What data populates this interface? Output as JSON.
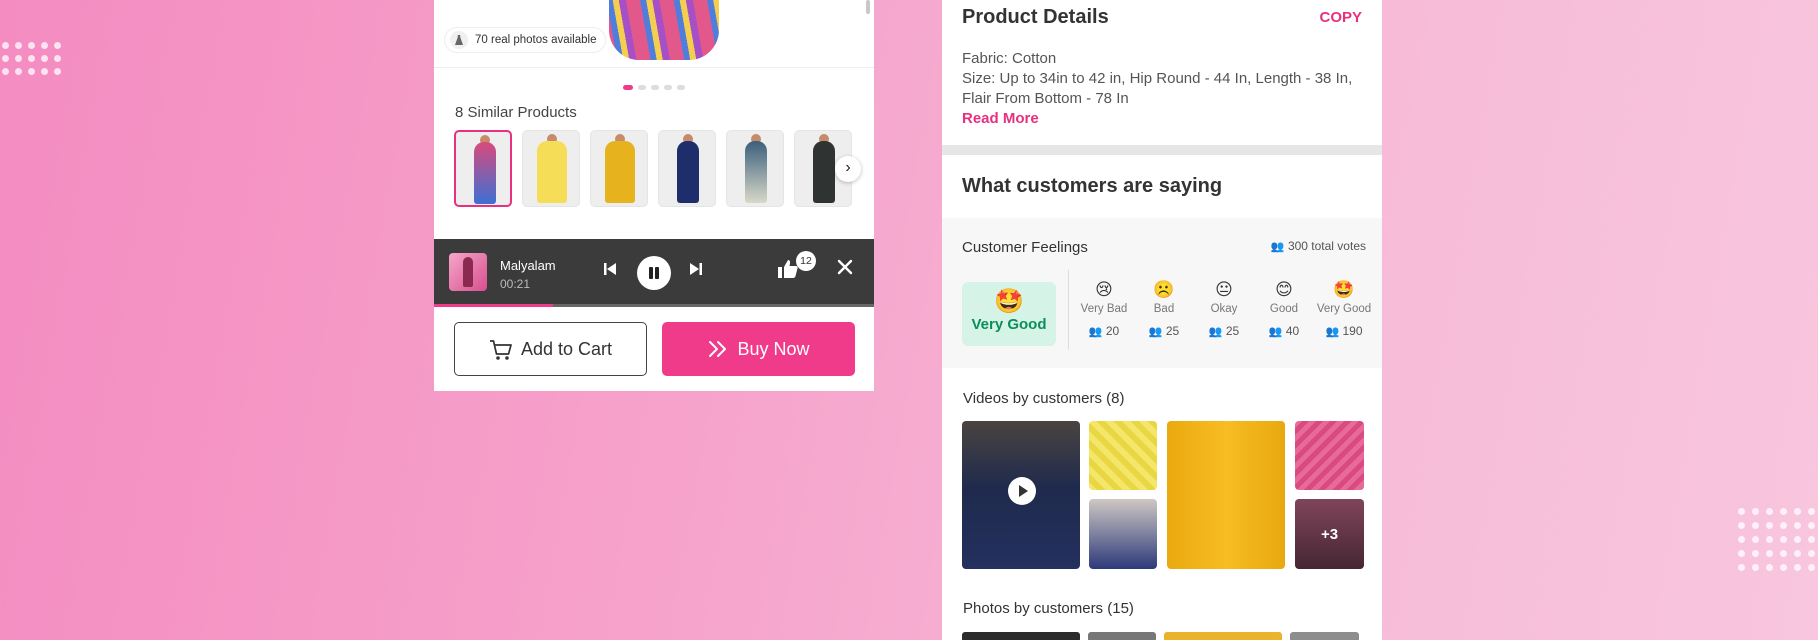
{
  "left": {
    "photos_badge": "70 real photos available",
    "similar_title": "8 Similar Products",
    "player": {
      "track_name": "Malyalam",
      "time": "00:21",
      "likes": "12",
      "progress": 0.27
    },
    "add_to_cart": "Add to Cart",
    "buy_now": "Buy Now"
  },
  "right": {
    "product_details_title": "Product Details",
    "copy_label": "COPY",
    "fabric": "Fabric: Cotton",
    "size": "Size: Up to 34in to 42 in, Hip Round - 44 In, Length - 38 In, Flair From Bottom - 78 In",
    "read_more": "Read More",
    "customers_saying": "What customers are saying",
    "feelings_title": "Customer Feelings",
    "total_votes": "300 total votes",
    "top_feeling": {
      "emoji": "🤩",
      "label": "Very Good"
    },
    "ratings": [
      {
        "emoji": "😢",
        "label": "Very Bad",
        "count": "20"
      },
      {
        "emoji": "☹️",
        "label": "Bad",
        "count": "25"
      },
      {
        "emoji": "😐",
        "label": "Okay",
        "count": "25"
      },
      {
        "emoji": "😊",
        "label": "Good",
        "count": "40"
      },
      {
        "emoji": "🤩",
        "label": "Very Good",
        "count": "190"
      }
    ],
    "videos_title": "Videos by customers (8)",
    "more_videos": "+3",
    "photos_title": "Photos by customers (15)"
  },
  "colors": {
    "accent": "#ef3b8a",
    "positive_bg": "#d6f3e8",
    "positive_text": "#0a8f5b",
    "player_bg": "#3b3b3b"
  }
}
